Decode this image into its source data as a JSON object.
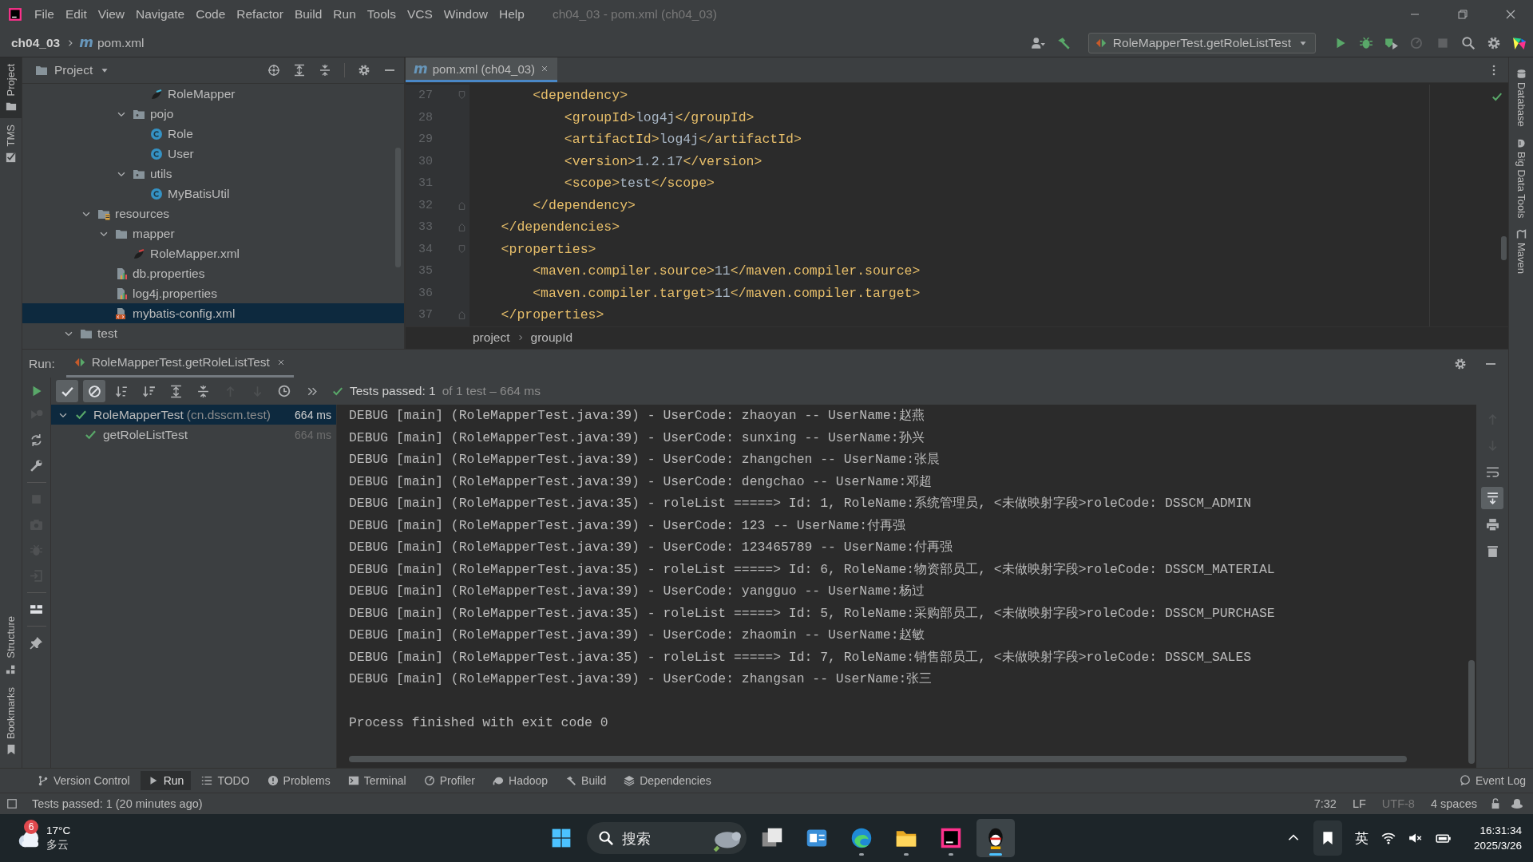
{
  "window": {
    "menu": [
      "File",
      "Edit",
      "View",
      "Navigate",
      "Code",
      "Refactor",
      "Build",
      "Run",
      "Tools",
      "VCS",
      "Window",
      "Help"
    ],
    "title": "ch04_03 - pom.xml (ch04_03)"
  },
  "navbar": {
    "project": "ch04_03",
    "file_glyph": "m",
    "file": "pom.xml",
    "run_config": "RoleMapperTest.getRoleListTest"
  },
  "left_stripe": {
    "top": [
      {
        "label": "Project",
        "kind": "folder",
        "selected": true
      },
      {
        "label": "TMS",
        "kind": "check",
        "selected": false
      }
    ],
    "bottom": [
      {
        "label": "Structure",
        "kind": "structure",
        "selected": false
      },
      {
        "label": "Bookmarks",
        "kind": "bookmark",
        "selected": false
      }
    ]
  },
  "right_stripe": [
    {
      "label": "Database",
      "kind": "database"
    },
    {
      "label": "Big Data Tools",
      "kind": "tools"
    },
    {
      "label": "Maven",
      "kind": "maven"
    }
  ],
  "project_panel": {
    "title": "Project",
    "tree": [
      {
        "children": [
          {
            "children": [
              {
                "children": [
                  {
                    "children": [
                      {
                        "name": "RoleMapper",
                        "kind": "mapper-interface",
                        "selected": false
                      }
                    ]
                  },
                  {
                    "name": "pojo",
                    "kind": "package",
                    "expanded": true,
                    "selected": false,
                    "children": [
                      {
                        "name": "Role",
                        "kind": "class",
                        "selected": false
                      },
                      {
                        "name": "User",
                        "kind": "class",
                        "selected": false
                      }
                    ]
                  },
                  {
                    "name": "utils",
                    "kind": "package",
                    "expanded": true,
                    "selected": false,
                    "children": [
                      {
                        "name": "MyBatisUtil",
                        "kind": "class",
                        "selected": false
                      }
                    ]
                  }
                ]
              }
            ]
          },
          {
            "name": "resources",
            "kind": "resources",
            "expanded": true,
            "selected": false,
            "children": [
              {
                "name": "mapper",
                "kind": "folder",
                "expanded": true,
                "selected": false,
                "children": [
                  {
                    "name": "RoleMapper.xml",
                    "kind": "mapper-xml",
                    "selected": false
                  }
                ]
              },
              {
                "name": "db.properties",
                "kind": "properties",
                "selected": false
              },
              {
                "name": "log4j.properties",
                "kind": "properties",
                "selected": false
              },
              {
                "name": "mybatis-config.xml",
                "kind": "xml",
                "selected": true
              }
            ]
          }
        ]
      },
      {
        "name": "test",
        "kind": "folder",
        "expanded": true,
        "selected": false
      }
    ]
  },
  "editor": {
    "tabs": [
      {
        "glyph": "m",
        "label": "pom.xml (ch04_03)",
        "selected": true
      }
    ],
    "lines": [
      {
        "number": "27",
        "kind": "fold-start",
        "code": "        <dependency>"
      },
      {
        "number": "28",
        "kind": "plain",
        "code": "            <groupId>log4j</groupId>"
      },
      {
        "number": "29",
        "kind": "plain",
        "code": "            <artifactId>log4j</artifactId>"
      },
      {
        "number": "30",
        "kind": "plain",
        "code": "            <version>1.2.17</version>"
      },
      {
        "number": "31",
        "kind": "plain",
        "code": "            <scope>test</scope>"
      },
      {
        "number": "32",
        "kind": "fold-end",
        "code": "        </dependency>"
      },
      {
        "number": "33",
        "kind": "fold-end",
        "code": "    </dependencies>"
      },
      {
        "number": "34",
        "kind": "fold-start",
        "code": "    <properties>"
      },
      {
        "number": "35",
        "kind": "plain",
        "code": "        <maven.compiler.source>11</maven.compiler.source>"
      },
      {
        "number": "36",
        "kind": "plain",
        "code": "        <maven.compiler.target>11</maven.compiler.target>"
      },
      {
        "number": "37",
        "kind": "fold-end",
        "code": "    </properties>"
      }
    ],
    "breadcrumbs": [
      "project",
      "groupId"
    ]
  },
  "run_panel": {
    "label": "Run:",
    "tabs": [
      {
        "label": "RoleMapperTest.getRoleListTest",
        "selected": true
      }
    ],
    "toolbar": [
      {
        "kind": "passed",
        "on": true,
        "disabled": false
      },
      {
        "kind": "ignored",
        "on": true,
        "disabled": false
      },
      {
        "kind": "sort-alpha",
        "on": false,
        "disabled": false
      },
      {
        "kind": "sort-duration",
        "on": false,
        "disabled": false
      },
      {
        "kind": "expand-all",
        "on": false,
        "disabled": false
      },
      {
        "kind": "collapse-all",
        "on": false,
        "disabled": false
      },
      {
        "kind": "previous",
        "on": false,
        "disabled": true
      },
      {
        "kind": "next",
        "on": false,
        "disabled": true
      },
      {
        "kind": "history",
        "on": false,
        "disabled": false
      },
      {
        "kind": "more",
        "on": false,
        "disabled": false
      }
    ],
    "summary": "Tests passed: 1",
    "summary_detail": "of 1 test – 664 ms",
    "side_tools": [
      {
        "kind": "rerun-failed",
        "disabled": true
      },
      {
        "kind": "auto-test",
        "disabled": false
      },
      {
        "kind": "settings",
        "disabled": false
      },
      {
        "kind": "stop",
        "disabled": true
      },
      {
        "kind": "camera",
        "disabled": true
      },
      {
        "kind": "debug",
        "disabled": true
      },
      {
        "kind": "import",
        "disabled": true
      },
      {
        "kind": "layout",
        "disabled": false
      },
      {
        "kind": "pin",
        "disabled": false
      }
    ],
    "tests": [
      {
        "name": "RoleMapperTest",
        "package": "(cn.dsscm.test)",
        "time": "664 ms",
        "expanded": true,
        "selected": true,
        "children": [
          {
            "name": "getRoleListTest",
            "time": "664 ms",
            "selected": false
          }
        ]
      }
    ],
    "console": [
      "DEBUG [main] (RoleMapperTest.java:39) - UserCode: zhaoyan -- UserName:赵燕",
      "DEBUG [main] (RoleMapperTest.java:39) - UserCode: sunxing -- UserName:孙兴",
      "DEBUG [main] (RoleMapperTest.java:39) - UserCode: zhangchen -- UserName:张晨",
      "DEBUG [main] (RoleMapperTest.java:39) - UserCode: dengchao -- UserName:邓超",
      "DEBUG [main] (RoleMapperTest.java:35) - roleList =====> Id: 1, RoleName:系统管理员, <未做映射字段>roleCode: DSSCM_ADMIN",
      "DEBUG [main] (RoleMapperTest.java:39) - UserCode: 123 -- UserName:付再强",
      "DEBUG [main] (RoleMapperTest.java:39) - UserCode: 123465789 -- UserName:付再强",
      "DEBUG [main] (RoleMapperTest.java:35) - roleList =====> Id: 6, RoleName:物资部员工, <未做映射字段>roleCode: DSSCM_MATERIAL",
      "DEBUG [main] (RoleMapperTest.java:39) - UserCode: yangguo -- UserName:杨过",
      "DEBUG [main] (RoleMapperTest.java:35) - roleList =====> Id: 5, RoleName:采购部员工, <未做映射字段>roleCode: DSSCM_PURCHASE",
      "DEBUG [main] (RoleMapperTest.java:39) - UserCode: zhaomin -- UserName:赵敏",
      "DEBUG [main] (RoleMapperTest.java:35) - roleList =====> Id: 7, RoleName:销售部员工, <未做映射字段>roleCode: DSSCM_SALES",
      "DEBUG [main] (RoleMapperTest.java:39) - UserCode: zhangsan -- UserName:张三"
    ],
    "exit_message": "Process finished with exit code 0",
    "console_tools": [
      {
        "kind": "up",
        "on": false,
        "disabled": true
      },
      {
        "kind": "down",
        "on": false,
        "disabled": true
      },
      {
        "kind": "wrap",
        "on": false,
        "disabled": false
      },
      {
        "kind": "scroll-end",
        "on": true,
        "disabled": false
      },
      {
        "kind": "print",
        "on": false,
        "disabled": false
      },
      {
        "kind": "clear",
        "on": false,
        "disabled": false
      }
    ]
  },
  "tool_windows": [
    {
      "label": "Version Control",
      "kind": "vcs",
      "selected": false
    },
    {
      "label": "Run",
      "kind": "run",
      "selected": true
    },
    {
      "label": "TODO",
      "kind": "todo",
      "selected": false
    },
    {
      "label": "Problems",
      "kind": "problems",
      "selected": false
    },
    {
      "label": "Terminal",
      "kind": "terminal",
      "selected": false
    },
    {
      "label": "Profiler",
      "kind": "profiler",
      "selected": false
    },
    {
      "label": "Hadoop",
      "kind": "hadoop",
      "selected": false
    },
    {
      "label": "Build",
      "kind": "build",
      "selected": false
    },
    {
      "label": "Dependencies",
      "kind": "dependencies",
      "selected": false
    }
  ],
  "event_log": "Event Log",
  "status_bar": {
    "message": "Tests passed: 1 (20 minutes ago)",
    "position": "7:32",
    "line_separator": "LF",
    "encoding": "UTF-8",
    "indent": "4 spaces"
  },
  "taskbar": {
    "weather": {
      "badge": "6",
      "temperature": "17°C",
      "condition": "多云"
    },
    "search": {
      "placeholder": "搜索"
    },
    "apps": [
      {
        "kind": "task-view",
        "running": false,
        "active": false
      },
      {
        "kind": "widgets",
        "running": false,
        "active": false
      },
      {
        "kind": "browser",
        "running": true,
        "active": false
      },
      {
        "kind": "files",
        "running": true,
        "active": false
      },
      {
        "kind": "ide",
        "running": true,
        "active": false
      },
      {
        "kind": "chat",
        "running": true,
        "active": true
      }
    ],
    "language": "英",
    "time": "16:31:34",
    "date": "2025/3/26"
  }
}
